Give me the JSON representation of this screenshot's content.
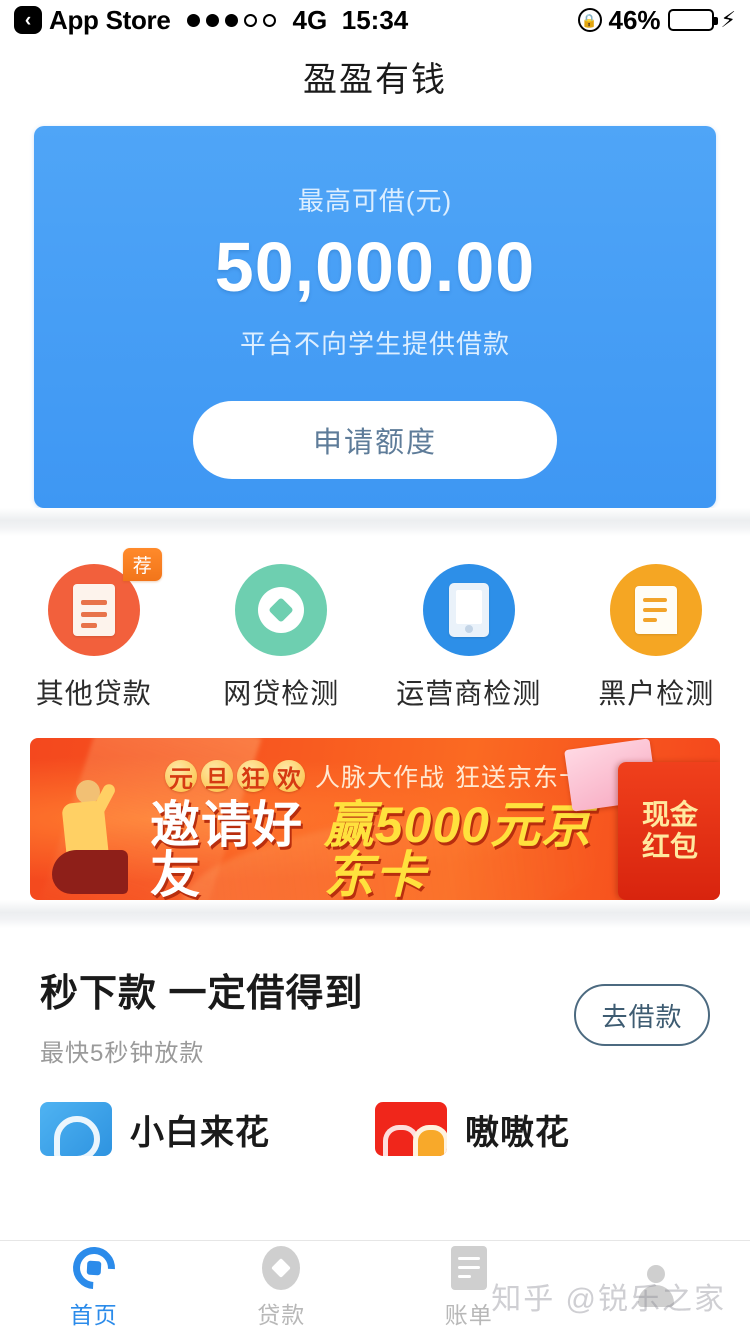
{
  "status_bar": {
    "back_label": "App Store",
    "back_icon": "chevron-left-icon",
    "signal_dots_filled": 3,
    "signal_dots_total": 5,
    "network": "4G",
    "time": "15:34",
    "rotation_lock_icon": "rotation-lock-icon",
    "battery_percent": "46%",
    "battery_level": 46,
    "battery_color": "#FFCC00",
    "charging_icon": "bolt-icon"
  },
  "header": {
    "title": "盈盈有钱"
  },
  "hero": {
    "label": "最高可借(元)",
    "amount": "50,000.00",
    "note": "平台不向学生提供借款",
    "button_label": "申请额度",
    "bg_color": "#4298F5",
    "button_text_color": "#5E7C99"
  },
  "quick_menu": [
    {
      "label": "其他贷款",
      "icon": "document-icon",
      "badge": "荐",
      "circle_color": "#F2603C"
    },
    {
      "label": "网贷检测",
      "icon": "target-ring-icon",
      "badge": "",
      "circle_color": "#6ECFB0"
    },
    {
      "label": "运营商检测",
      "icon": "phone-icon",
      "badge": "",
      "circle_color": "#2D8FE8"
    },
    {
      "label": "黑户检测",
      "icon": "note-icon",
      "badge": "",
      "circle_color": "#F5A623"
    }
  ],
  "banner": {
    "highlight_chars": [
      "元",
      "旦",
      "狂",
      "欢"
    ],
    "top_text_1": "人脉大作战",
    "top_text_2": "狂送京东卡",
    "main_text_1": "邀请好友",
    "main_text_2": "赢5000元京东卡",
    "envelope_line1": "现金",
    "envelope_line2": "红包",
    "bg_color": "#F4481E",
    "accent_color": "#FFE13D"
  },
  "loan_promo": {
    "title": "秒下款 一定借得到",
    "subtitle": "最快5秒钟放款",
    "button_label": "去借款",
    "button_border_color": "#4C6A80"
  },
  "products": [
    {
      "name": "小白来花",
      "icon": "wave-app-icon",
      "icon_color": "#2E93E0"
    },
    {
      "name": "嗷嗷花",
      "icon": "faces-app-icon",
      "icon_color": "#F0261B"
    }
  ],
  "tab_bar": {
    "active_color": "#2B8BEA",
    "inactive_color": "#b8b8b8",
    "items": [
      {
        "label": "首页",
        "icon": "home-icon",
        "active": true
      },
      {
        "label": "贷款",
        "icon": "loan-icon",
        "active": false
      },
      {
        "label": "账单",
        "icon": "bill-icon",
        "active": false
      },
      {
        "label": "",
        "icon": "user-icon",
        "active": false
      }
    ]
  },
  "watermark": {
    "text": "知乎 @锐乐之家"
  }
}
